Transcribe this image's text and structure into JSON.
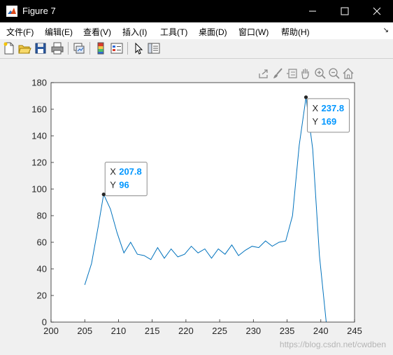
{
  "window": {
    "title": "Figure 7"
  },
  "menu": [
    {
      "label": "文件(F)"
    },
    {
      "label": "编辑(E)"
    },
    {
      "label": "查看(V)"
    },
    {
      "label": "插入(I)"
    },
    {
      "label": "工具(T)"
    },
    {
      "label": "桌面(D)"
    },
    {
      "label": "窗口(W)"
    },
    {
      "label": "帮助(H)"
    }
  ],
  "toolbar": {
    "buttons": [
      "new-figure-icon",
      "open-file-icon",
      "save-icon",
      "print-icon",
      "link-plot-icon",
      "colorbar-icon",
      "legend-icon",
      "pointer-icon",
      "property-inspector-icon"
    ]
  },
  "axes_toolbar": {
    "buttons": [
      "export-icon",
      "brush-icon",
      "data-tips-icon",
      "pan-icon",
      "zoom-in-icon",
      "zoom-out-icon",
      "home-icon"
    ]
  },
  "colors": {
    "line": "#0072bd",
    "datatip_value": "#0096ff",
    "plot_bg": "#ffffff",
    "figure_bg": "#f0f0f0"
  },
  "chart_data": {
    "type": "line",
    "xlim": [
      200,
      245
    ],
    "ylim": [
      0,
      180
    ],
    "x_ticks": [
      200,
      205,
      210,
      215,
      220,
      225,
      230,
      235,
      240,
      245
    ],
    "y_ticks": [
      0,
      20,
      40,
      60,
      80,
      100,
      120,
      140,
      160,
      180
    ],
    "grid": false,
    "series": [
      {
        "x": [
          205,
          206,
          207,
          207.8,
          208.8,
          209.8,
          210.8,
          211.8,
          212.8,
          213.8,
          214.8,
          215.8,
          216.8,
          217.8,
          218.8,
          219.8,
          220.8,
          221.8,
          222.8,
          223.8,
          224.8,
          225.8,
          226.8,
          227.8,
          228.8,
          229.8,
          230.8,
          231.8,
          232.8,
          233.8,
          234.8,
          235.8,
          236.8,
          237.8,
          238.8,
          239.8,
          240.8
        ],
        "y": [
          28,
          44,
          72,
          96,
          85,
          67,
          52,
          60,
          51,
          50,
          47,
          56,
          48,
          55,
          49,
          51,
          57,
          52,
          55,
          48,
          55,
          51,
          58,
          50,
          54,
          57,
          56,
          61,
          57,
          60,
          61,
          80,
          133,
          169,
          130,
          50,
          0
        ]
      }
    ],
    "datatips": [
      {
        "x_label": "X",
        "x_value": "207.8",
        "y_label": "Y",
        "y_value": "96",
        "x": 207.8,
        "y": 96
      },
      {
        "x_label": "X",
        "x_value": "237.8",
        "y_label": "Y",
        "y_value": "169",
        "x": 237.8,
        "y": 169
      }
    ]
  },
  "watermark": "https://blog.csdn.net/cwdben"
}
